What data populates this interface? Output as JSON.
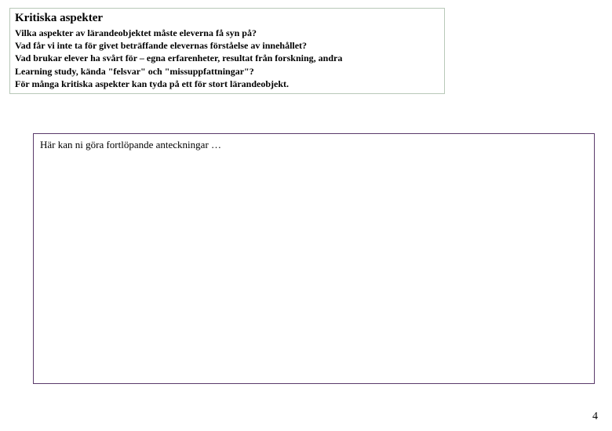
{
  "header": {
    "title": "Kritiska aspekter",
    "lines": [
      "Vilka aspekter av lärandeobjektet måste eleverna få syn på?",
      "Vad får vi inte ta för givet beträffande elevernas förståelse av innehållet?",
      "Vad brukar elever ha svårt för – egna erfarenheter, resultat från forskning, andra",
      "Learning study, kända \"felsvar\" och \"missuppfattningar\"?",
      "För många kritiska aspekter kan tyda på ett för stort lärandeobjekt."
    ]
  },
  "notes": {
    "placeholder": "Här kan ni göra fortlöpande anteckningar …"
  },
  "page_number": "4"
}
